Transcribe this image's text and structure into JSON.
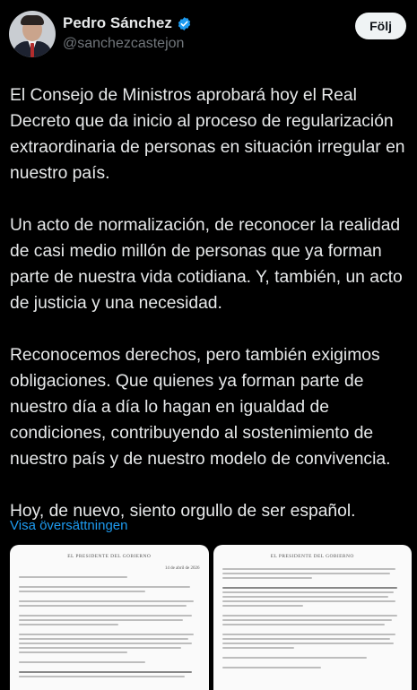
{
  "author": {
    "name": "Pedro Sánchez",
    "handle": "@sanchezcastejon",
    "verified_icon": "verified-badge-icon"
  },
  "follow_button": {
    "label": "Följ"
  },
  "tweet": {
    "paragraphs": [
      "El Consejo de Ministros aprobará hoy el Real Decreto que da inicio al proceso de regularización extraordinaria de personas en situación irregular en nuestro país.",
      "Un acto de normalización, de reconocer la realidad de casi medio millón de personas que ya forman parte de nuestra vida cotidiana. Y, también, un acto de justicia y una necesidad.",
      "Reconocemos derechos, pero también exigimos obligaciones. Que quienes ya forman parte de nuestro día a día lo hagan en igualdad de condiciones, contribuyendo al sostenimiento de nuestro país y de nuestro modelo de convivencia.",
      " Hoy, de nuevo, siento orgullo de ser español."
    ]
  },
  "translate_link": "Visa översättningen",
  "media": {
    "doc1": {
      "header": "EL PRESIDENTE DEL GOBIERNO",
      "date": "14 de abril de 2026"
    },
    "doc2": {
      "header": "EL PRESIDENTE DEL GOBIERNO"
    }
  },
  "colors": {
    "background": "#000000",
    "link": "#1d9bf0",
    "verified": "#1d9bf0"
  }
}
